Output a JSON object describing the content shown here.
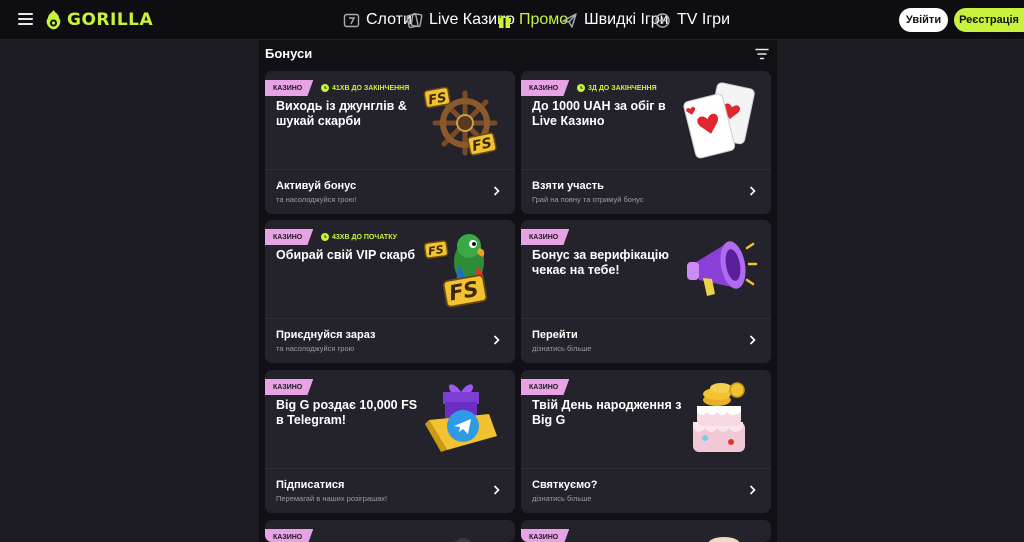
{
  "header": {
    "logo_text": "GORILLA",
    "nav": [
      {
        "label": "Слоти",
        "icon": "slots-icon"
      },
      {
        "label": "Live Казино",
        "icon": "cards-icon"
      },
      {
        "label": "Промо",
        "icon": "gift-icon",
        "active": true
      },
      {
        "label": "Швидкі Ігри",
        "icon": "plane-icon"
      },
      {
        "label": "TV Ігри",
        "icon": "tv-games-icon"
      }
    ],
    "login_label": "Увійти",
    "register_label": "Реєстрація"
  },
  "colors": {
    "accent": "#c8f23c",
    "tag": "#e7a3e6",
    "card": "#24232b",
    "panel": "#111015"
  },
  "main": {
    "title": "Бонуси",
    "cards": [
      {
        "tag": "КАЗИНО",
        "timer": "41ХВ ДО ЗАКІНЧЕННЯ",
        "title": "Виходь із джунглів & шукай скарби",
        "cta": "Активуй бонус",
        "sub": "та насолоджуйся грою!",
        "art": "ship-wheel-fs"
      },
      {
        "tag": "КАЗИНО",
        "timer": "3Д ДО ЗАКІНЧЕННЯ",
        "title": "До 1000 UAH за обіг в Live Казино",
        "cta": "Взяти участь",
        "sub": "Грай на повну та отримуй бонус",
        "art": "playing-cards"
      },
      {
        "tag": "КАЗИНО",
        "timer": "43ХВ ДО ПОЧАТКУ",
        "title": "Обирай свій VIP скарб",
        "cta": "Приєднуйся зараз",
        "sub": "та насолоджуйся грою",
        "art": "parrot-fs"
      },
      {
        "tag": "КАЗИНО",
        "timer": "",
        "title": "Бонус за верифікацію чекає на тебе!",
        "cta": "Перейти",
        "sub": "дізнатись більше",
        "art": "megaphone"
      },
      {
        "tag": "КАЗИНО",
        "timer": "",
        "title": "Big G роздає 10,000 FS в Telegram!",
        "cta": "Підписатися",
        "sub": "Перемагай в наших розіграшах!",
        "art": "telegram-gift"
      },
      {
        "tag": "КАЗИНО",
        "timer": "",
        "title": "Твій День народження з Big G",
        "cta": "Святкуємо?",
        "sub": "дізнатись більше",
        "art": "birthday-cake"
      },
      {
        "tag": "КАЗИНО",
        "timer": "",
        "title": "",
        "cta": "",
        "sub": "",
        "art": ""
      },
      {
        "tag": "КАЗИНО",
        "timer": "",
        "title": "",
        "cta": "",
        "sub": "",
        "art": ""
      }
    ]
  }
}
